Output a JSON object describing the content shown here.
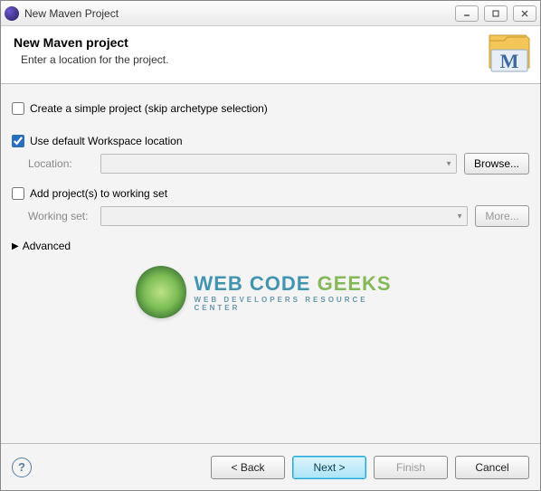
{
  "window": {
    "title": "New Maven Project"
  },
  "banner": {
    "heading": "New Maven project",
    "subheading": "Enter a location for the project."
  },
  "options": {
    "simple_project_label": "Create a simple project (skip archetype selection)",
    "simple_project_checked": false,
    "default_workspace_label": "Use default Workspace location",
    "default_workspace_checked": true,
    "location_label": "Location:",
    "location_value": "",
    "browse_label": "Browse...",
    "add_working_set_label": "Add project(s) to working set",
    "add_working_set_checked": false,
    "working_set_label": "Working set:",
    "working_set_value": "",
    "more_label": "More...",
    "advanced_label": "Advanced"
  },
  "watermark": {
    "line1a": "WEB CODE ",
    "line1b": "GEEKS",
    "line2": "WEB DEVELOPERS RESOURCE CENTER"
  },
  "footer": {
    "back": "< Back",
    "next": "Next >",
    "finish": "Finish",
    "cancel": "Cancel"
  }
}
